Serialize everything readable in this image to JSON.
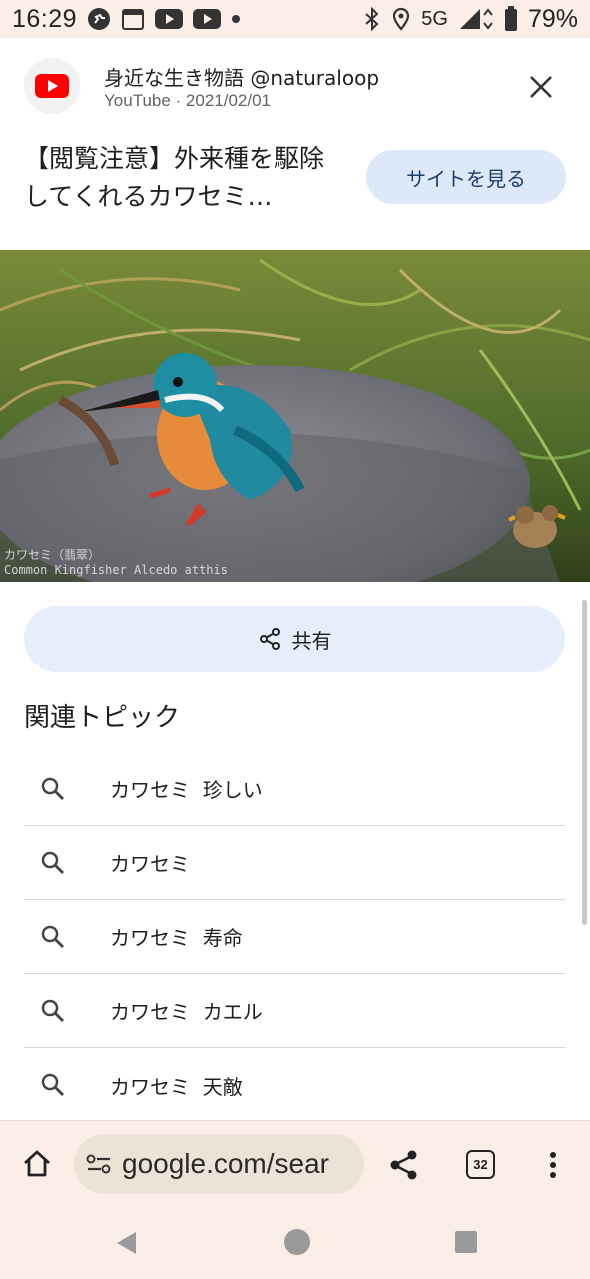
{
  "status_bar": {
    "time": "16:29",
    "calendar_day": "31",
    "network": "5G",
    "battery": "79%"
  },
  "header": {
    "channel": "身近な生き物語 @naturaloop",
    "source_date": "YouTube · 2021/02/01",
    "close_icon": "close-icon"
  },
  "video": {
    "title": "【閲覧注意】外来種を駆除してくれるカワセミ…",
    "visit_site_label": "サイトを見る",
    "caption": "カワセミ（翡翠）\nCommon Kingfisher Alcedo atthis"
  },
  "share": {
    "label": "共有",
    "icon": "share-icon"
  },
  "related": {
    "heading": "関連トピック",
    "items": [
      {
        "label": "カワセミ  珍しい"
      },
      {
        "label": "カワセミ"
      },
      {
        "label": "カワセミ  寿命"
      },
      {
        "label": "カワセミ  カエル"
      },
      {
        "label": "カワセミ  天敵"
      }
    ]
  },
  "toolbar": {
    "url": "google.com/sear",
    "tab_count": "32"
  },
  "colors": {
    "accent_pill": "#dde8f8",
    "share_pill": "#e6eefb",
    "chrome_bg": "#fbeee6",
    "youtube_red": "#ff0000"
  }
}
